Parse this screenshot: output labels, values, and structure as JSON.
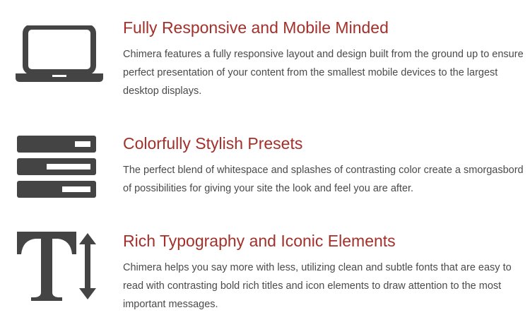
{
  "colors": {
    "title": "#a3302a",
    "body_text": "#4a4a4a",
    "icon": "#444444"
  },
  "features": [
    {
      "icon": "laptop-icon",
      "title": "Fully Responsive and Mobile Minded",
      "body": "Chimera features a fully responsive layout and design built from the ground up to ensure perfect presentation of your content from the smallest mobile devices to the largest desktop displays."
    },
    {
      "icon": "presets-stack-icon",
      "title": "Colorfully Stylish Presets",
      "body": "The perfect blend of whitespace and splashes of contrasting color create a smorgasbord of possibilities for giving your site the look and feel you are after."
    },
    {
      "icon": "typography-icon",
      "title": "Rich Typography and Iconic Elements",
      "body": "Chimera helps you say more with less, utilizing clean and subtle fonts that are easy to read with contrasting bold rich titles and icon elements to draw attention to the most important messages."
    }
  ]
}
